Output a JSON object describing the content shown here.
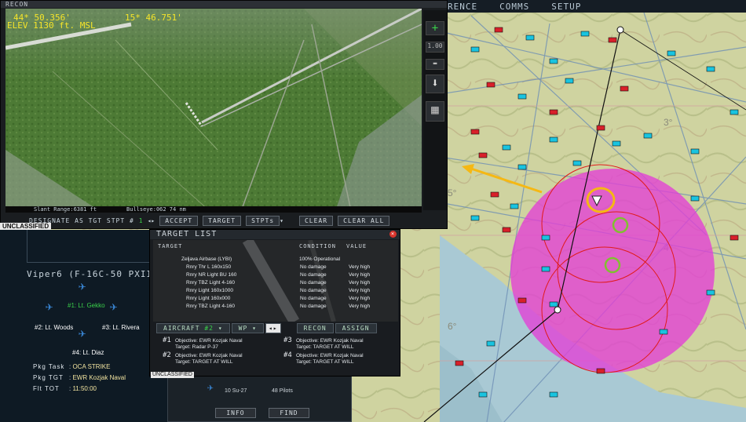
{
  "top_menu": [
    "RENCE",
    "COMMS",
    "SETUP"
  ],
  "recon": {
    "title": "RECON",
    "lat": "44* 50.356'",
    "lon": "15* 46.751'",
    "elev": "ELEV 1130 ft. MSL",
    "slant_range": "Slant Range:6381 ft",
    "bullseye": "Bullseye:062  74 nm",
    "zoom_value": "1.00",
    "designate_label": "DESIGNATE AS TGT STPT #",
    "stpt_number": "1",
    "buttons": {
      "accept": "ACCEPT",
      "target": "TARGET",
      "stpts": "STPTs",
      "clear": "CLEAR",
      "clear_all": "CLEAR ALL"
    }
  },
  "unclassified": "UNCLASSIFIED",
  "flight": {
    "callsign": "Viper6 (F-16C-50 PXII)",
    "pilots": [
      "#1: Lt. Gekko",
      "#2: Lt. Woods",
      "#3: Lt. Rivera",
      "#4: Lt. Diaz"
    ],
    "pkg_task_label": "Pkg Task",
    "pkg_task": "OCA STRIKE",
    "pkg_tgt_label": "Pkg TGT",
    "pkg_tgt": "EWR Kozjak Naval",
    "flt_tot_label": "Flt TOT",
    "flt_tot": "11:50:00"
  },
  "target_list": {
    "title": "TARGET LIST",
    "headers": {
      "target": "TARGET",
      "condition": "CONDITION",
      "value": "VALUE"
    },
    "airbase": {
      "name": "Zeljava Airbase (LYBI)",
      "condition": "100% Operational"
    },
    "rows": [
      {
        "name": "Rnry Thr L 160x150",
        "condition": "No damage",
        "value": "Very high"
      },
      {
        "name": "Rnry NR Light BU 160",
        "condition": "No damage",
        "value": "Very high"
      },
      {
        "name": "Rnry TBZ Light 4-160",
        "condition": "No damage",
        "value": "Very high"
      },
      {
        "name": "Rnry Light 160x1000",
        "condition": "No damage",
        "value": "Very high"
      },
      {
        "name": "Rnry Light 160x000",
        "condition": "No damage",
        "value": "Very high"
      },
      {
        "name": "Rnry TBZ Light 4-160",
        "condition": "No damage",
        "value": "Very high"
      }
    ],
    "tabs": {
      "aircraft": "AIRCRAFT",
      "aircraft_num": "#2",
      "wp": "WP",
      "recon": "RECON",
      "assign": "ASSIGN"
    },
    "objectives": [
      {
        "num": "#1",
        "objective": "Objective: EWR Kozjak Naval",
        "target": "Target: Radar P-37"
      },
      {
        "num": "#3",
        "objective": "Objective: EWR Kozjak Naval",
        "target": "Target: TARGET AT WILL"
      },
      {
        "num": "#2",
        "objective": "Objective: EWR Kozjak Naval",
        "target": "Target: TARGET AT WILL"
      },
      {
        "num": "#4",
        "objective": "Objective: EWR Kozjak Naval",
        "target": "Target: TARGET AT WILL"
      }
    ]
  },
  "bottom_panel": {
    "flight_info": "10 Su-27",
    "pilots": "48 Pilots",
    "info_btn": "INFO",
    "find_btn": "FIND"
  },
  "map": {
    "grid_labels": [
      "3°",
      "4°",
      "5°",
      "6°"
    ],
    "colors": {
      "land": "#cbcf9a",
      "sea": "#a9c9d4",
      "threat_circle": "#e33fd6",
      "highlight": "#f5b814"
    }
  }
}
